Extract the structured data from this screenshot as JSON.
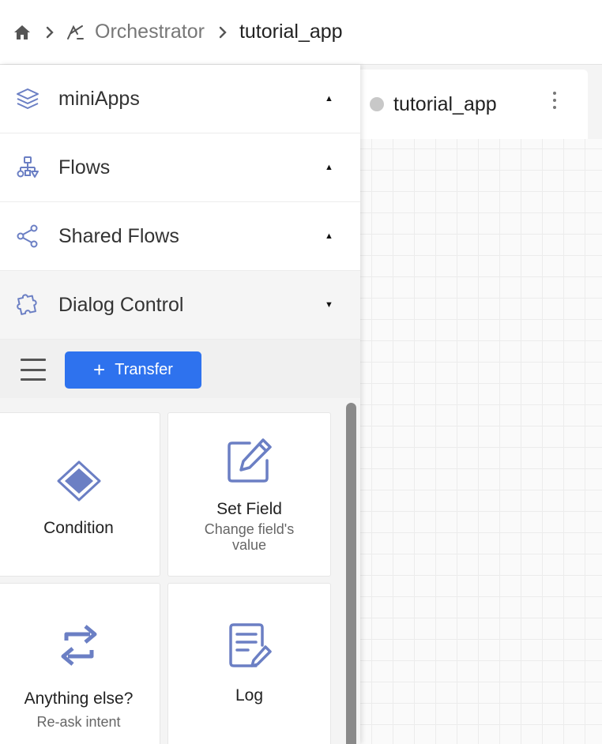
{
  "breadcrumb": {
    "home_icon": "home-icon",
    "separator_icon": "chevron-right-icon",
    "parent": "Orchestrator",
    "current": "tutorial_app"
  },
  "tab": {
    "label": "tutorial_app",
    "status_color": "#c8c8c8"
  },
  "sidebar": {
    "sections": [
      {
        "label": "miniApps",
        "icon": "layers-icon",
        "caret": "▲"
      },
      {
        "label": "Flows",
        "icon": "flow-hierarchy-icon",
        "caret": "▲"
      },
      {
        "label": "Shared Flows",
        "icon": "share-icon",
        "caret": "▲"
      },
      {
        "label": "Dialog Control",
        "icon": "puzzle-icon",
        "caret": "▼"
      }
    ],
    "toolbar": {
      "transfer_label": "Transfer",
      "plus": "+"
    },
    "cards": [
      {
        "title": "Condition",
        "subtitle": "",
        "icon": "diamond-icon"
      },
      {
        "title": "Set Field",
        "subtitle": "Change field's value",
        "icon": "edit-icon"
      },
      {
        "title": "Anything else?",
        "subtitle": "Re-ask intent",
        "icon": "repeat-icon"
      },
      {
        "title": "Log",
        "subtitle": "",
        "icon": "log-icon"
      }
    ]
  },
  "colors": {
    "accent": "#2e72ee",
    "icon": "#6b7fc4"
  }
}
